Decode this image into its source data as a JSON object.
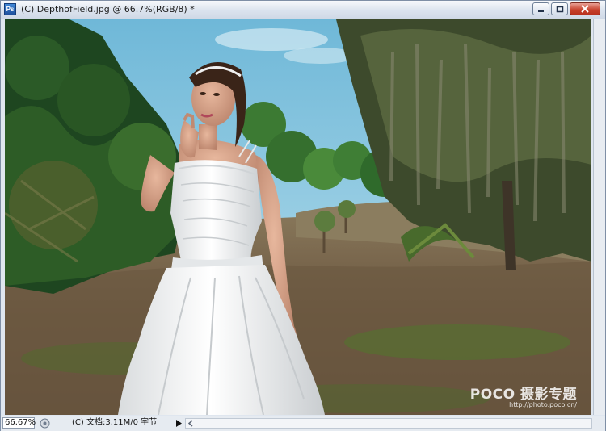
{
  "window": {
    "app_icon_label": "Ps",
    "title": "(C) DepthofField.jpg @ 66.7%(RGB/8) *"
  },
  "status": {
    "zoom": "66.67%",
    "doc_info": "(C) 文档:3.11M/0 字节"
  },
  "watermark": {
    "brand": "POCO 摄影专题",
    "url": "http://photo.poco.cn/"
  },
  "colors": {
    "sky": "#8cc9e0",
    "foliage_dark": "#1f4a1e",
    "ground": "#6e5a44",
    "dress": "#f4f4f4",
    "close_button": "#c7402b"
  }
}
